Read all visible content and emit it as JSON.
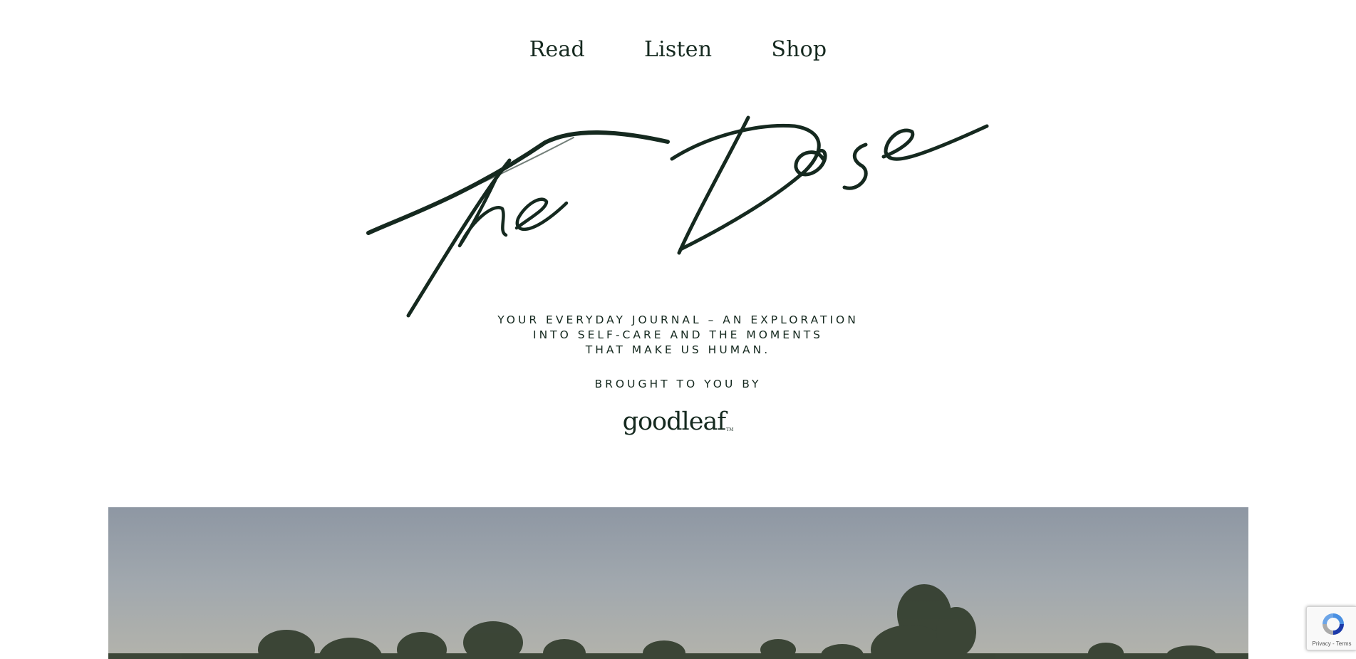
{
  "nav": {
    "items": [
      {
        "label": "Read"
      },
      {
        "label": "Listen"
      },
      {
        "label": "Shop"
      }
    ]
  },
  "logo": {
    "text": "The Dose",
    "icon": "script-wordmark"
  },
  "tagline": {
    "lines": [
      "YOUR EVERYDAY JOURNAL – AN EXPLORATION",
      "INTO SELF-CARE AND THE MOMENTS",
      "THAT MAKE US HUMAN."
    ]
  },
  "sponsor": {
    "intro": "BROUGHT TO YOU BY",
    "brand": "goodleaf",
    "trademark": "TM"
  },
  "hero": {
    "description_icon": "landscape-photo"
  },
  "recaptcha": {
    "links": "Privacy - Terms",
    "icon": "recaptcha-icon"
  },
  "colors": {
    "ink": "#15291f",
    "background": "#ffffff"
  }
}
